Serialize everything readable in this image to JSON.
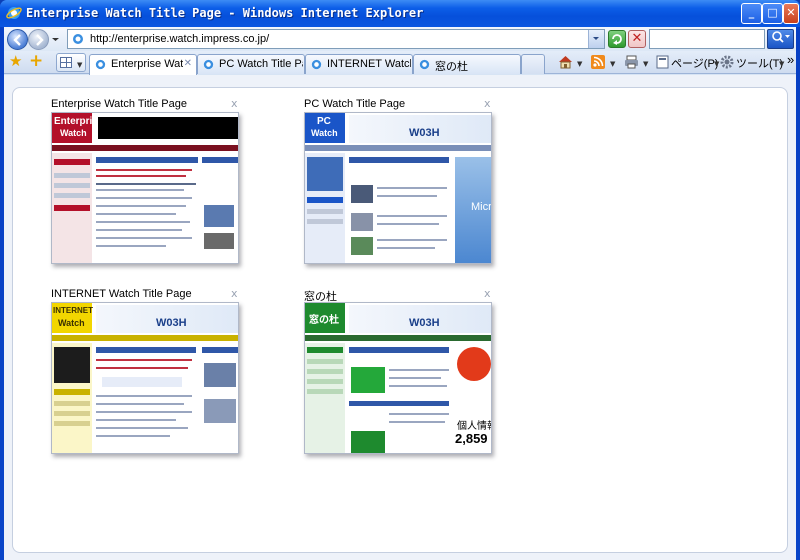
{
  "window": {
    "title": "Enterprise Watch Title Page - Windows Internet Explorer",
    "min_glyph": "_",
    "max_glyph": "□",
    "close_glyph": "✕"
  },
  "address_bar": {
    "url": "http://enterprise.watch.impress.co.jp/",
    "search_placeholder": ""
  },
  "tabs": [
    {
      "label": "Enterprise Wat...",
      "active": true,
      "close": "✕"
    },
    {
      "label": "PC Watch Title Pa...",
      "active": false
    },
    {
      "label": "INTERNET Watch ...",
      "active": false
    },
    {
      "label": "窓の杜",
      "active": false
    }
  ],
  "command_bar": {
    "page_label": "ページ(P)",
    "tools_label": "ツール(T)",
    "chevron": "»",
    "icons": [
      "home-icon",
      "feeds-icon",
      "print-icon"
    ]
  },
  "thumbnails": [
    {
      "title": "Enterprise Watch Title Page",
      "close": "x",
      "logo_top": "Enterprise",
      "logo_bottom": "Watch",
      "accent": "#b3102a"
    },
    {
      "title": "PC Watch Title Page",
      "close": "x",
      "logo_top": "PC",
      "logo_bottom": "Watch",
      "ad_text": "W03H",
      "side_text": "Micro",
      "accent": "#1a55c8"
    },
    {
      "title": "INTERNET Watch Title Page",
      "close": "x",
      "logo_top": "INTERNET",
      "logo_bottom": "Watch",
      "ad_text": "W03H",
      "accent": "#f2d600"
    },
    {
      "title": "窓の杜",
      "close": "x",
      "logo_top": "窓の杜",
      "ad_text": "W03H",
      "side_text": "個人情報",
      "side_num": "2,859",
      "accent": "#1e8a2e"
    }
  ],
  "colors": {
    "title_bar": "#0650db",
    "tab_border": "#8aa4cc",
    "panel_bg": "#ffffff"
  }
}
